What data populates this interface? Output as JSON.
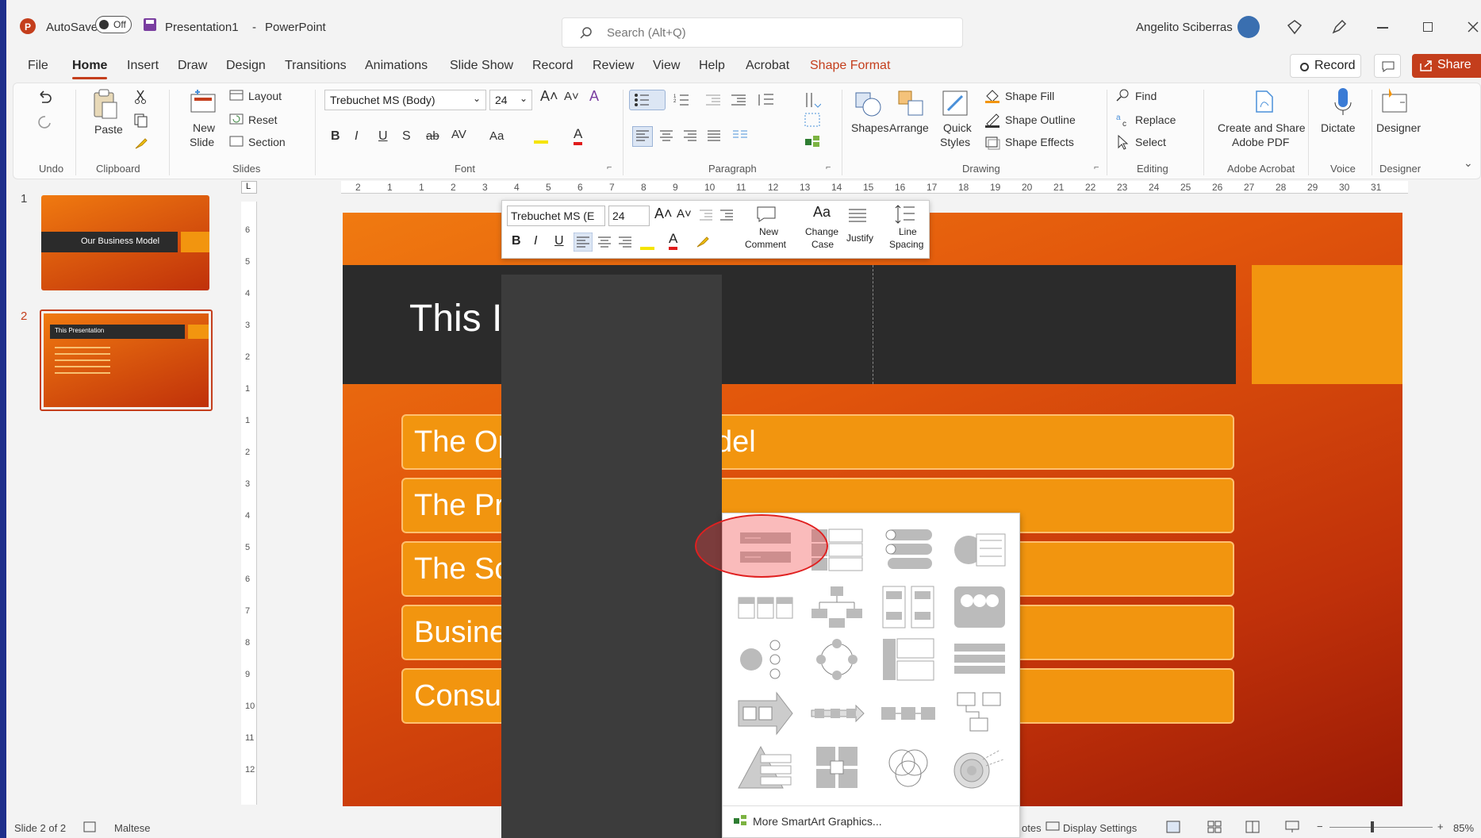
{
  "titlebar": {
    "autosave_label": "AutoSave",
    "autosave_state": "Off",
    "filename": "Presentation1",
    "separator": "-",
    "app": "PowerPoint",
    "search_placeholder": "Search (Alt+Q)",
    "user": "Angelito Sciberras"
  },
  "tabs": [
    "File",
    "Home",
    "Insert",
    "Draw",
    "Design",
    "Transitions",
    "Animations",
    "Slide Show",
    "Record",
    "Review",
    "View",
    "Help",
    "Acrobat",
    "Shape Format"
  ],
  "right_buttons": {
    "record": "Record",
    "share": "Share"
  },
  "ribbon": {
    "paste": "Paste",
    "new": "New",
    "slide": "Slide",
    "layout": "Layout",
    "reset": "Reset",
    "section": "Section",
    "font_name": "Trebuchet MS (Body)",
    "font_size": "24",
    "shapes": "Shapes",
    "arrange": "Arrange",
    "quick": "Quick",
    "styles": "Styles",
    "shape_fill": "Shape Fill",
    "shape_outline": "Shape Outline",
    "shape_effects": "Shape Effects",
    "find": "Find",
    "replace": "Replace",
    "select": "Select",
    "create_share_1": "Create and Share",
    "create_share_2": "Adobe PDF",
    "dictate": "Dictate",
    "designer": "Designer",
    "groups": {
      "undo": "Undo",
      "clipboard": "Clipboard",
      "slides": "Slides",
      "font": "Font",
      "paragraph": "Paragraph",
      "drawing": "Drawing",
      "editing": "Editing",
      "adobe": "Adobe Acrobat",
      "voice": "Voice",
      "designer": "Designer"
    }
  },
  "ruler_numbers": [
    "2",
    "1",
    "1",
    "2",
    "3",
    "4",
    "5",
    "6",
    "7",
    "8",
    "9",
    "10",
    "11",
    "12",
    "13",
    "14",
    "15",
    "16",
    "17",
    "18",
    "19",
    "20",
    "21",
    "22",
    "23",
    "24",
    "25",
    "26",
    "27",
    "28",
    "29",
    "30",
    "31"
  ],
  "vruler_numbers": [
    "6",
    "5",
    "4",
    "3",
    "2",
    "1",
    "1",
    "2",
    "3",
    "4",
    "5",
    "6",
    "7",
    "8",
    "9",
    "10",
    "11",
    "12"
  ],
  "thumbnails": [
    {
      "num": "1",
      "title": "Our Business Model"
    },
    {
      "num": "2",
      "title": "This Presentation"
    }
  ],
  "slide": {
    "title": "This I",
    "bars": [
      "The Op",
      "The Pr",
      "The Sc",
      "Busine",
      "Consu"
    ],
    "bar1_tail": "del"
  },
  "mini_toolbar": {
    "font": "Trebuchet MS (E",
    "size": "24",
    "new_comment_1": "New",
    "new_comment_2": "Comment",
    "change_case_1": "Change",
    "change_case_2": "Case",
    "justify": "Justify",
    "line_spacing_1": "Line",
    "line_spacing_2": "Spacing"
  },
  "smartart": {
    "more": "More SmartArt Graphics..."
  },
  "status": {
    "slide": "Slide 2 of 2",
    "language": "Maltese",
    "notes": "otes",
    "display": "Display Settings",
    "zoom": "85%"
  },
  "colors": {
    "accent": "#c43e1c",
    "slide_orange": "#f2950f",
    "slide_dark": "#2b2b2b",
    "highlight_circle": "#e02020"
  }
}
